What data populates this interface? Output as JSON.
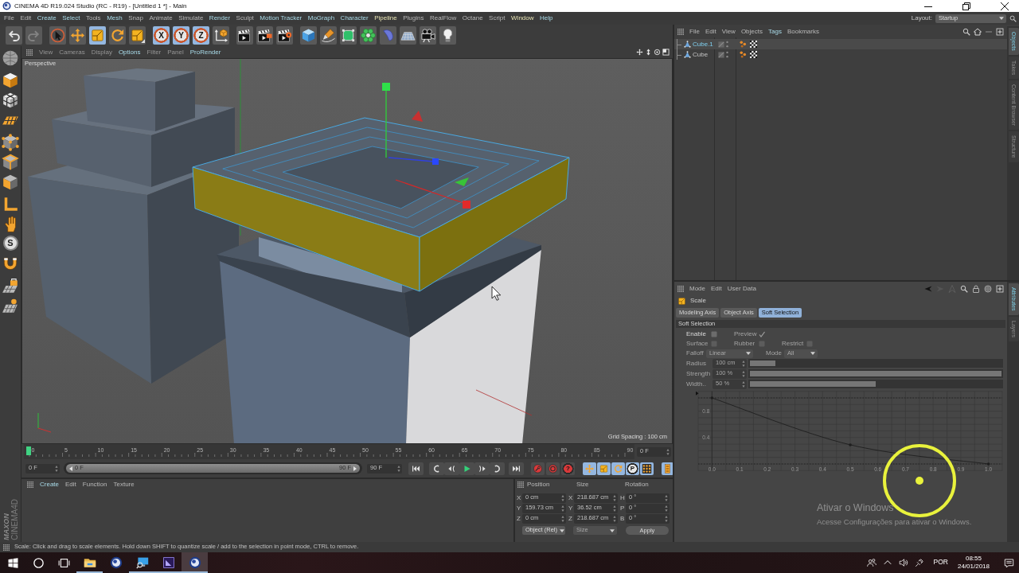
{
  "window": {
    "title": "CINEMA 4D R19.024 Studio (RC - R19) - [Untitled 1 *] - Main"
  },
  "menu_bar": {
    "items": [
      {
        "label": "File",
        "kind": "normal"
      },
      {
        "label": "Edit",
        "kind": "normal"
      },
      {
        "label": "Create",
        "kind": "highlight"
      },
      {
        "label": "Select",
        "kind": "highlight"
      },
      {
        "label": "Tools",
        "kind": "normal"
      },
      {
        "label": "Mesh",
        "kind": "highlight"
      },
      {
        "label": "Snap",
        "kind": "normal"
      },
      {
        "label": "Animate",
        "kind": "normal"
      },
      {
        "label": "Simulate",
        "kind": "normal"
      },
      {
        "label": "Render",
        "kind": "highlight"
      },
      {
        "label": "Sculpt",
        "kind": "normal"
      },
      {
        "label": "Motion Tracker",
        "kind": "highlight"
      },
      {
        "label": "MoGraph",
        "kind": "highlight"
      },
      {
        "label": "Character",
        "kind": "highlight"
      },
      {
        "label": "Pipeline",
        "kind": "custom"
      },
      {
        "label": "Plugins",
        "kind": "normal"
      },
      {
        "label": "RealFlow",
        "kind": "normal"
      },
      {
        "label": "Octane",
        "kind": "normal"
      },
      {
        "label": "Script",
        "kind": "normal"
      },
      {
        "label": "Window",
        "kind": "custom"
      },
      {
        "label": "Help",
        "kind": "highlight"
      }
    ],
    "layout_label": "Layout:",
    "layout": "Startup"
  },
  "toolbar": [
    [
      {
        "kind": "undo",
        "active": false,
        "disabled": false
      },
      {
        "kind": "redo",
        "active": false,
        "disabled": true
      }
    ],
    [
      {
        "kind": "select",
        "active": false,
        "disabled": false
      },
      {
        "kind": "move",
        "active": false,
        "disabled": false
      },
      {
        "kind": "scale",
        "active": true,
        "disabled": false
      },
      {
        "kind": "rotate",
        "active": false,
        "disabled": false
      },
      {
        "kind": "recent",
        "active": false,
        "disabled": false
      }
    ],
    [
      {
        "kind": "axis",
        "label": "X",
        "active": true,
        "disabled": false
      },
      {
        "kind": "axis",
        "label": "Y",
        "active": true,
        "disabled": false
      },
      {
        "kind": "axis",
        "label": "Z",
        "active": true,
        "disabled": false
      },
      {
        "kind": "coords",
        "active": false,
        "disabled": false
      }
    ],
    [
      {
        "kind": "render_view",
        "active": false,
        "disabled": false
      },
      {
        "kind": "render_picture",
        "active": false,
        "disabled": false
      },
      {
        "kind": "render_settings",
        "active": false,
        "disabled": false
      }
    ],
    [
      {
        "kind": "cube",
        "active": false,
        "disabled": false
      },
      {
        "kind": "pen",
        "active": false,
        "disabled": false
      },
      {
        "kind": "subdivision",
        "active": false,
        "disabled": false
      },
      {
        "kind": "cloner",
        "active": false,
        "disabled": false
      },
      {
        "kind": "deformer",
        "active": false,
        "disabled": false
      },
      {
        "kind": "floor",
        "active": false,
        "disabled": false
      },
      {
        "kind": "camera",
        "active": false,
        "disabled": false
      },
      {
        "kind": "light",
        "active": false,
        "disabled": false
      }
    ]
  ],
  "palette": [
    [
      {
        "kind": "editable"
      }
    ],
    [
      {
        "kind": "model"
      },
      {
        "kind": "texture"
      },
      {
        "kind": "workplane"
      }
    ],
    [
      {
        "kind": "points"
      },
      {
        "kind": "edges"
      },
      {
        "kind": "polygons"
      }
    ],
    [
      {
        "kind": "axis"
      },
      {
        "kind": "tweak"
      },
      {
        "kind": "solo",
        "label": "S"
      }
    ],
    [
      {
        "kind": "snap"
      }
    ],
    [
      {
        "kind": "lockplane"
      },
      {
        "kind": "plane"
      }
    ]
  ],
  "logo": {
    "brand": "MAXON",
    "product": "CINEMA4D"
  },
  "viewport": {
    "menu": [
      {
        "label": "View",
        "kind": "dim"
      },
      {
        "label": "Cameras",
        "kind": "dim"
      },
      {
        "label": "Display",
        "kind": "dim"
      },
      {
        "label": "Options",
        "kind": "highlight"
      },
      {
        "label": "Filter",
        "kind": "dim"
      },
      {
        "label": "Panel",
        "kind": "dim"
      },
      {
        "label": "ProRender",
        "kind": "highlight"
      }
    ],
    "camera": "Perspective",
    "grid_spacing": "Grid Spacing : 100 cm"
  },
  "timeline": {
    "ticks": [
      "0",
      "5",
      "10",
      "15",
      "20",
      "25",
      "30",
      "35",
      "40",
      "45",
      "50",
      "55",
      "60",
      "65",
      "70",
      "75",
      "80",
      "85",
      "90"
    ],
    "playhead": {
      "level": 0
    },
    "current_frame": "0 F",
    "start_field": "0 F",
    "range": {
      "start": "0 F",
      "end": "90 F",
      "level": 1
    },
    "end_field": "90 F",
    "transport": [
      [
        {
          "kind": "first"
        }
      ],
      [
        {
          "kind": "prev_key"
        },
        {
          "kind": "prev_frame"
        },
        {
          "kind": "play"
        },
        {
          "kind": "next_frame"
        },
        {
          "kind": "next_key"
        }
      ],
      [
        {
          "kind": "last"
        }
      ]
    ],
    "record": [
      {
        "kind": "record"
      },
      {
        "kind": "autokey"
      },
      {
        "kind": "keyframe_selection",
        "label": "?"
      }
    ],
    "keying": [
      {
        "kind": "move",
        "active": true
      },
      {
        "kind": "scale",
        "active": true
      },
      {
        "kind": "rotate",
        "active": true
      },
      {
        "kind": "param",
        "label": "P",
        "active": true
      },
      {
        "kind": "points_key",
        "active": true
      }
    ],
    "timeline_button": {
      "active": true
    }
  },
  "material_manager": {
    "menu": [
      {
        "label": "Create",
        "kind": "highlight"
      },
      {
        "label": "Edit",
        "kind": "normal"
      },
      {
        "label": "Function",
        "kind": "normal"
      },
      {
        "label": "Texture",
        "kind": "normal"
      }
    ]
  },
  "coordinates": {
    "headers": [
      "Position",
      "Size",
      "Rotation"
    ],
    "rows": [
      [
        {
          "axis": "X",
          "value": "0 cm"
        },
        {
          "axis": "X",
          "value": "218.687 cm"
        },
        {
          "axis": "H",
          "value": "0 °"
        }
      ],
      [
        {
          "axis": "Y",
          "value": "159.73 cm"
        },
        {
          "axis": "Y",
          "value": "36.52 cm"
        },
        {
          "axis": "P",
          "value": "0 °"
        }
      ],
      [
        {
          "axis": "Z",
          "value": "0 cm"
        },
        {
          "axis": "Z",
          "value": "218.687 cm"
        },
        {
          "axis": "B",
          "value": "0 °"
        }
      ]
    ],
    "mode": "Object (Rel)",
    "size_mode": {
      "value": "Size",
      "disabled": true
    },
    "apply": "Apply"
  },
  "object_manager": {
    "menu": [
      {
        "label": "File",
        "kind": "normal"
      },
      {
        "label": "Edit",
        "kind": "normal"
      },
      {
        "label": "View",
        "kind": "normal"
      },
      {
        "label": "Objects",
        "kind": "normal"
      },
      {
        "label": "Tags",
        "kind": "highlight"
      },
      {
        "label": "Bookmarks",
        "kind": "normal"
      }
    ],
    "objects": [
      {
        "name": "Cube.1",
        "selected": true
      },
      {
        "name": "Cube",
        "selected": false
      }
    ],
    "side_tabs": [
      {
        "label": "Objects",
        "selected": true
      },
      {
        "label": "Takes",
        "selected": false
      },
      {
        "label": "Content Browser",
        "selected": false
      },
      {
        "label": "Structure",
        "selected": false
      }
    ]
  },
  "attributes": {
    "menu": [
      {
        "label": "Mode"
      },
      {
        "label": "Edit"
      },
      {
        "label": "User Data"
      }
    ],
    "tool": "Scale",
    "tabs": [
      {
        "label": "Modeling Axis",
        "selected": false
      },
      {
        "label": "Object Axis",
        "selected": false
      },
      {
        "label": "Soft Selection",
        "selected": true
      }
    ],
    "section": "Soft Selection",
    "checkbox_rows": [
      [
        {
          "label": "Enable",
          "checked": false,
          "disabled": false
        },
        {
          "label": "Preview",
          "checked": true,
          "disabled": true
        }
      ],
      [
        {
          "label": "Surface",
          "checked": false,
          "disabled": true
        },
        {
          "label": "Rubber",
          "checked": false,
          "disabled": true
        },
        {
          "label": "Restrict",
          "checked": false,
          "disabled": true
        }
      ]
    ],
    "dropdowns": [
      {
        "label": "Falloff",
        "value": "Linear",
        "disabled": true
      },
      {
        "label": "Mode",
        "value": "All",
        "disabled": true
      }
    ],
    "sliders": [
      {
        "label": "Radius",
        "value": "100 cm",
        "level": 0.1,
        "disabled": true
      },
      {
        "label": "Strength",
        "value": "100 %",
        "level": 1,
        "disabled": true
      },
      {
        "label": "Width..",
        "value": "50 %",
        "level": 0.5,
        "disabled": true
      }
    ],
    "chart_data": {
      "type": "line",
      "x": [
        0,
        0.5,
        1
      ],
      "values": [
        1,
        0.29,
        0
      ],
      "xlim": [
        -0.05,
        1.05
      ],
      "ylim": [
        -0.1,
        1.1
      ],
      "grid": true,
      "ref_lines": [
        {
          "axis": "y",
          "value": 0
        },
        {
          "axis": "y",
          "value": 1
        }
      ],
      "xticks": [
        {
          "value": 0,
          "label": "0.0"
        },
        {
          "value": 0.1,
          "label": "0.1"
        },
        {
          "value": 0.2,
          "label": "0.2"
        },
        {
          "value": 0.3,
          "label": "0.3"
        },
        {
          "value": 0.4,
          "label": "0.4"
        },
        {
          "value": 0.5,
          "label": "0.5"
        },
        {
          "value": 0.6,
          "label": "0.6"
        },
        {
          "value": 0.7,
          "label": "0.7"
        },
        {
          "value": 0.8,
          "label": "0.8"
        },
        {
          "value": 0.9,
          "label": "0.9"
        },
        {
          "value": 1,
          "label": "1.0"
        }
      ],
      "yticks": [
        {
          "value": 0.4,
          "label": "0.4"
        },
        {
          "value": 0.8,
          "label": "0.8"
        }
      ]
    },
    "side_tabs": [
      {
        "label": "Attributes",
        "selected": true
      },
      {
        "label": "Layers",
        "selected": false
      }
    ]
  },
  "status_bar": "Scale: Click and drag to scale elements. Hold down SHIFT to quantize scale / add to the selection in point mode, CTRL to remove.",
  "activation_notice": {
    "title": "Ativar o Windows",
    "message": "Acesse Configurações para ativar o Windows."
  },
  "taskbar": {
    "system": [
      {
        "kind": "start"
      },
      {
        "kind": "ring"
      },
      {
        "kind": "task_view"
      }
    ],
    "apps": [
      {
        "kind": "folder",
        "running": true,
        "selected": false
      },
      {
        "kind": "sphere",
        "running": false,
        "selected": false
      },
      {
        "kind": "monitor",
        "running": true,
        "selected": false
      },
      {
        "kind": "chart_app",
        "running": true,
        "selected": false
      },
      {
        "kind": "sphere",
        "running": true,
        "selected": true
      }
    ],
    "tray": [
      {
        "kind": "people"
      },
      {
        "kind": "chevron"
      },
      {
        "kind": "volume"
      },
      {
        "kind": "network"
      }
    ],
    "language": "POR",
    "time": "08:55",
    "date": "24/01/2018"
  }
}
